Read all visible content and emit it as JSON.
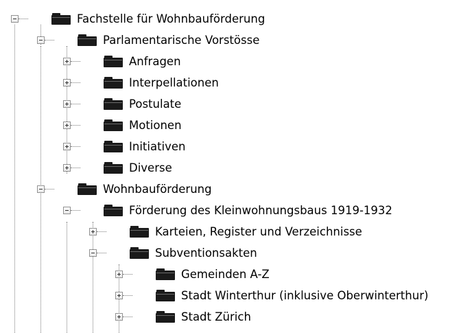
{
  "tree": {
    "nodes": [
      {
        "label": "Fachstelle für Wohnbauförderung",
        "state": "expanded"
      },
      {
        "label": "Parlamentarische Vorstösse",
        "state": "expanded"
      },
      {
        "label": "Anfragen",
        "state": "collapsed"
      },
      {
        "label": "Interpellationen",
        "state": "collapsed"
      },
      {
        "label": "Postulate",
        "state": "collapsed"
      },
      {
        "label": "Motionen",
        "state": "collapsed"
      },
      {
        "label": "Initiativen",
        "state": "collapsed"
      },
      {
        "label": "Diverse",
        "state": "collapsed"
      },
      {
        "label": "Wohnbauförderung",
        "state": "expanded"
      },
      {
        "label": "Förderung des Kleinwohnungsbaus 1919-1932",
        "state": "expanded"
      },
      {
        "label": "Karteien, Register und Verzeichnisse",
        "state": "collapsed"
      },
      {
        "label": "Subventionsakten",
        "state": "expanded"
      },
      {
        "label": "Gemeinden A-Z",
        "state": "collapsed"
      },
      {
        "label": "Stadt Winterthur (inklusive Oberwinterthur)",
        "state": "collapsed"
      },
      {
        "label": "Stadt Zürich",
        "state": "collapsed"
      }
    ]
  },
  "icons": {
    "node": "folder-icon",
    "expanded": "minus-icon",
    "collapsed": "plus-icon"
  },
  "colors": {
    "folder": "#1a1a1a",
    "connector": "#7a7a7a",
    "toggle_border": "#919191"
  }
}
